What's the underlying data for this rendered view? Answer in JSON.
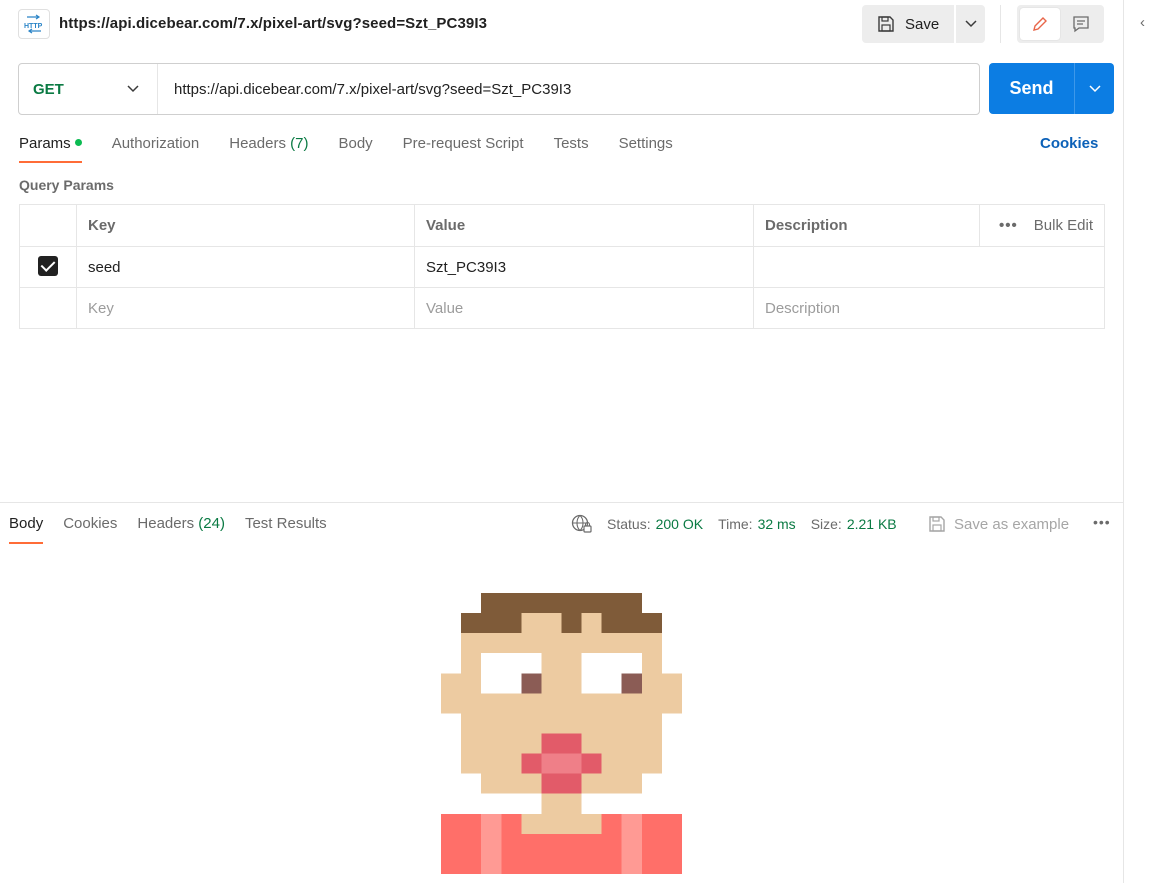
{
  "title": {
    "text": "https://api.dicebear.com/7.x/pixel-art/svg?seed=Szt_PC39I3",
    "icon": "http-file-icon",
    "icon_text": "HTTP"
  },
  "toolbar": {
    "save_label": "Save"
  },
  "request": {
    "method": "GET",
    "url": "https://api.dicebear.com/7.x/pixel-art/svg?seed=Szt_PC39I3",
    "send_label": "Send"
  },
  "req_tabs": [
    {
      "label": "Params",
      "active": true
    },
    {
      "label": "Authorization"
    },
    {
      "label": "Headers",
      "count": "(7)"
    },
    {
      "label": "Body"
    },
    {
      "label": "Pre-request Script"
    },
    {
      "label": "Tests"
    },
    {
      "label": "Settings"
    }
  ],
  "cookies_label": "Cookies",
  "query_params": {
    "section_label": "Query Params",
    "headers": {
      "key": "Key",
      "value": "Value",
      "description": "Description",
      "bulk_edit": "Bulk Edit"
    },
    "rows": [
      {
        "checked": true,
        "key": "seed",
        "value": "Szt_PC39I3",
        "description": ""
      }
    ],
    "placeholders": {
      "key": "Key",
      "value": "Value",
      "description": "Description"
    }
  },
  "response": {
    "tabs": [
      {
        "label": "Body",
        "active": true
      },
      {
        "label": "Cookies"
      },
      {
        "label": "Headers",
        "count": "(24)"
      },
      {
        "label": "Test Results"
      }
    ],
    "status_label": "Status:",
    "status_value": "200 OK",
    "time_label": "Time:",
    "time_value": "32 ms",
    "size_label": "Size:",
    "size_value": "2.21 KB",
    "save_example_label": "Save as example"
  },
  "colors": {
    "accent": "#ff6c37",
    "send_blue": "#0c7de3",
    "method_green": "#0a7a43",
    "hair": "#7f5b39",
    "skin": "#edcba1",
    "eye": "#8b5c55",
    "mouth": "#e25b69",
    "mouth_light": "#ef7f88",
    "shirt": "#ff6f69",
    "shirt_stripe": "#ff9a94"
  }
}
